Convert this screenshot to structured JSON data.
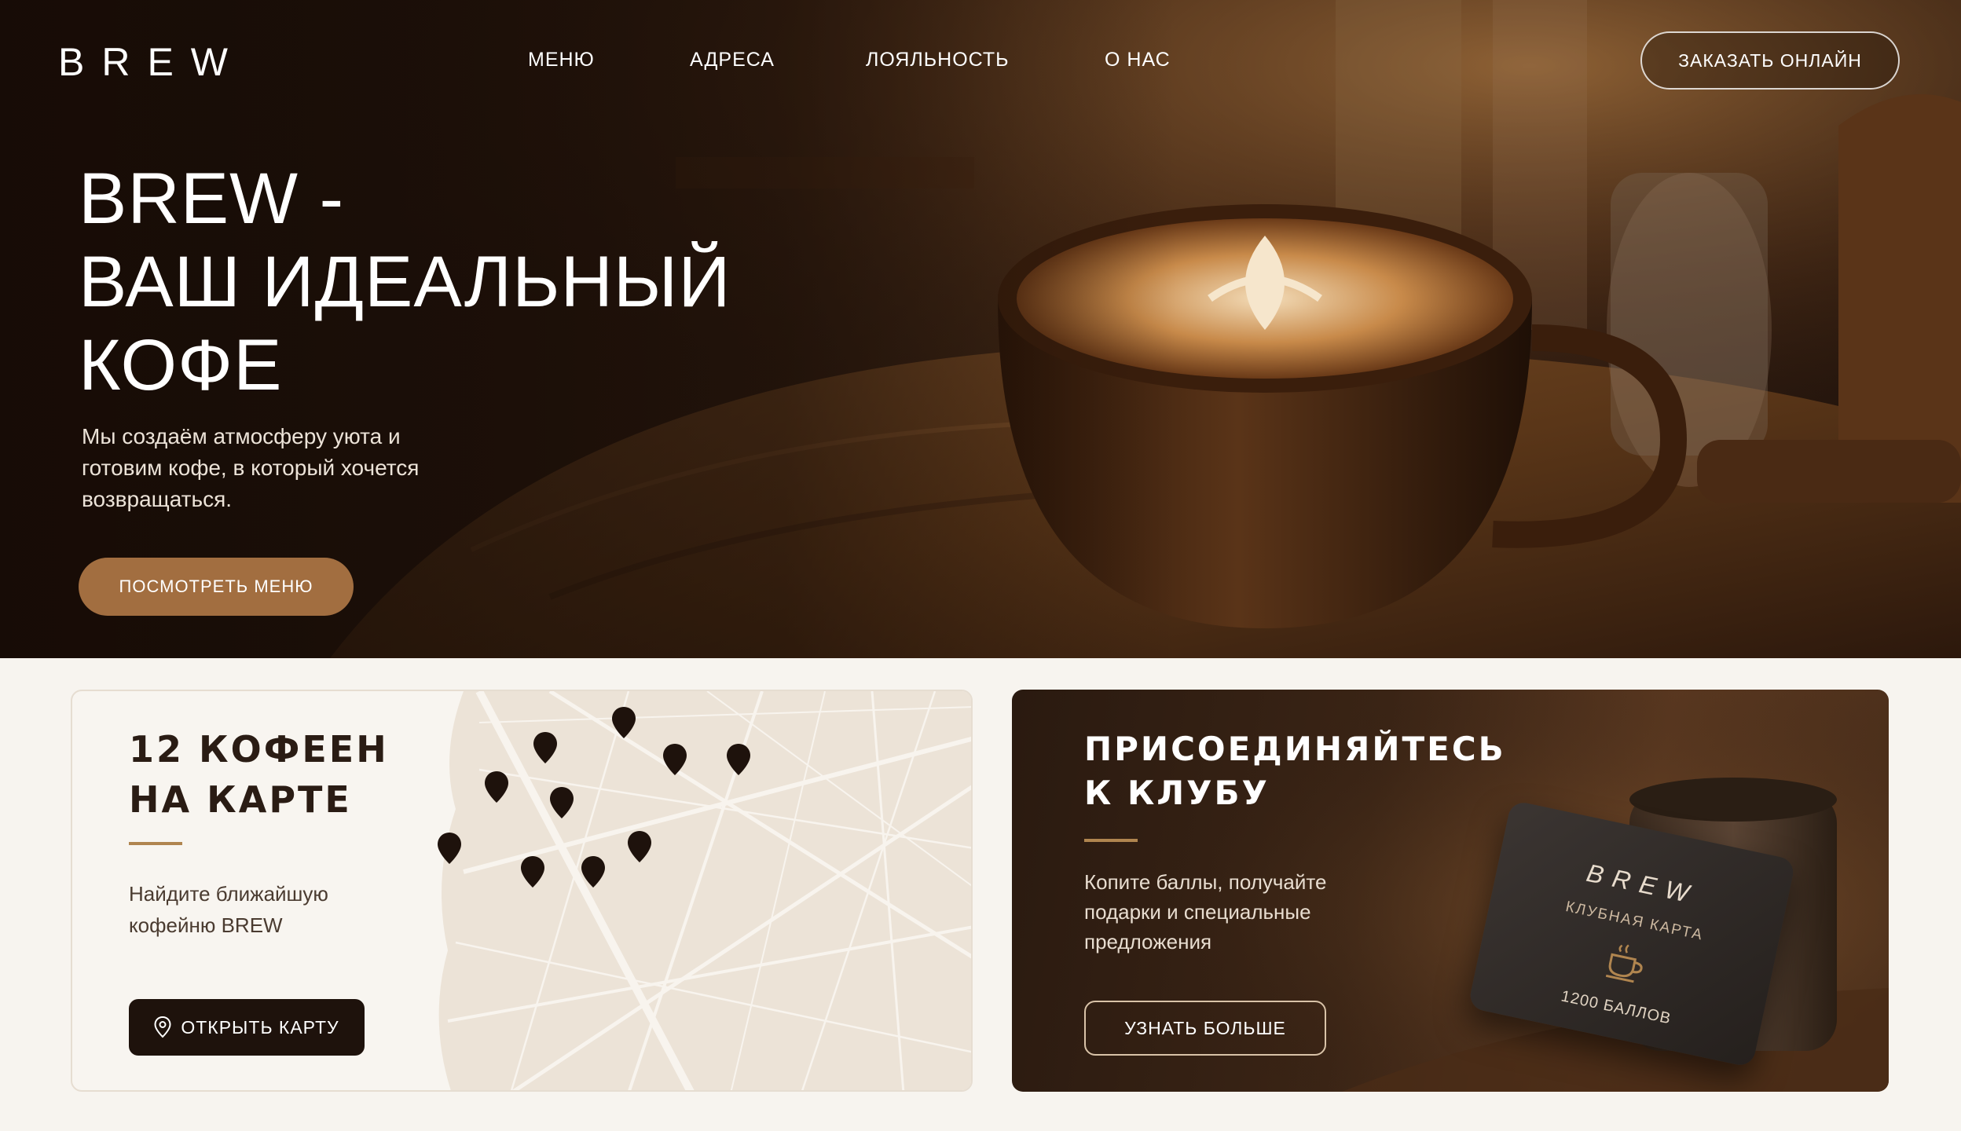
{
  "header": {
    "logo": "BREW",
    "nav": [
      "МЕНЮ",
      "АДРЕСА",
      "ЛОЯЛЬНОСТЬ",
      "О НАС"
    ],
    "order_button": "ЗАКАЗАТЬ ОНЛАЙН"
  },
  "hero": {
    "title_line1": "BREW -",
    "title_line2": "ВАШ ИДЕАЛЬНЫЙ",
    "title_line3": "КОФЕ",
    "subtitle": "Мы создаём атмосферу уюта и готовим кофе, в который хочется возвращаться.",
    "menu_button": "ПОСМОТРЕТЬ МЕНЮ"
  },
  "map_card": {
    "title_line1": "12 КОФЕЕН",
    "title_line2": "НА КАРТЕ",
    "text": "Найдите ближайшую кофейню BREW",
    "button": "ОТКРЫТЬ КАРТУ",
    "icon": "map-pin-icon"
  },
  "club_card": {
    "title_line1": "ПРИСОЕДИНЯЙТЕСЬ",
    "title_line2": "К КЛУБУ",
    "text": "Копите баллы, получайте подарки и специальные предложения",
    "button": "УЗНАТЬ БОЛЬШЕ",
    "loyalty_card": {
      "logo": "BREW",
      "subtitle": "КЛУБНАЯ КАРТА",
      "points": "1200 БАЛЛОВ",
      "icon": "coffee-cup-icon"
    }
  },
  "colors": {
    "accent": "#a26e40",
    "dark": "#1e120c",
    "divider": "#b0854f",
    "background": "#f7f4ef"
  }
}
